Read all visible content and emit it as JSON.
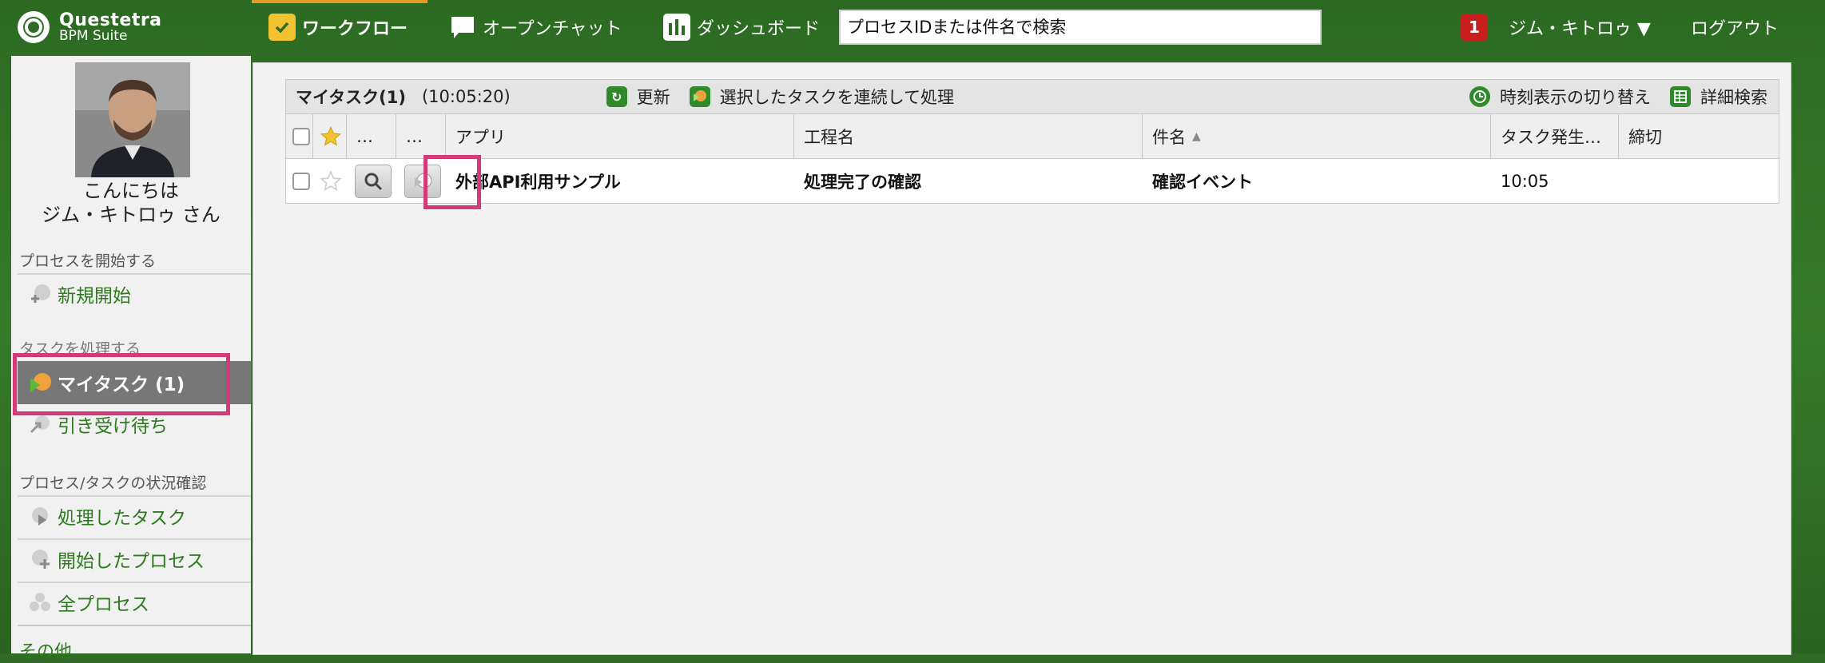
{
  "app": {
    "logo_name": "Questetra",
    "logo_sub": "BPM Suite"
  },
  "nav": {
    "tabs": [
      {
        "label": "ワークフロー"
      },
      {
        "label": "オープンチャット"
      },
      {
        "label": "ダッシュボード"
      }
    ],
    "search_placeholder": "プロセスIDまたは件名で検索",
    "notification_count": "1",
    "user_menu": "ジム・キトロゥ ▼",
    "logout": "ログアウト"
  },
  "sidebar": {
    "greeting_line1": "こんにちは",
    "greeting_line2": "ジム・キトロゥ さん",
    "sections": [
      {
        "label": "プロセスを開始する"
      },
      {
        "label": "タスクを処理する"
      },
      {
        "label": "プロセス/タスクの状況確認"
      },
      {
        "label": "その他"
      }
    ],
    "items": [
      {
        "label": "新規開始"
      },
      {
        "label": "マイタスク (1)"
      },
      {
        "label": "引き受け待ち"
      },
      {
        "label": "処理したタスク"
      },
      {
        "label": "開始したプロセス"
      },
      {
        "label": "全プロセス"
      }
    ]
  },
  "grid": {
    "title": "マイタスク(1)",
    "time": "(10:05:20)",
    "refresh": "更新",
    "batch_process": "選択したタスクを連続して処理",
    "toggle_time": "時刻表示の切り替え",
    "advanced_search": "詳細検索",
    "columns": {
      "more1": "…",
      "more2": "…",
      "app": "アプリ",
      "step": "工程名",
      "subject": "件名",
      "task_created": "タスク発生…",
      "deadline": "締切"
    },
    "rows": [
      {
        "app": "外部API利用サンプル",
        "step": "処理完了の確認",
        "subject": "確認イベント",
        "task_created": "10:05",
        "deadline": ""
      }
    ]
  },
  "colors": {
    "brand_green": "#2f6b25",
    "link_green": "#2e7a1f",
    "highlight": "#d33a79",
    "badge_red": "#c81e1e"
  }
}
